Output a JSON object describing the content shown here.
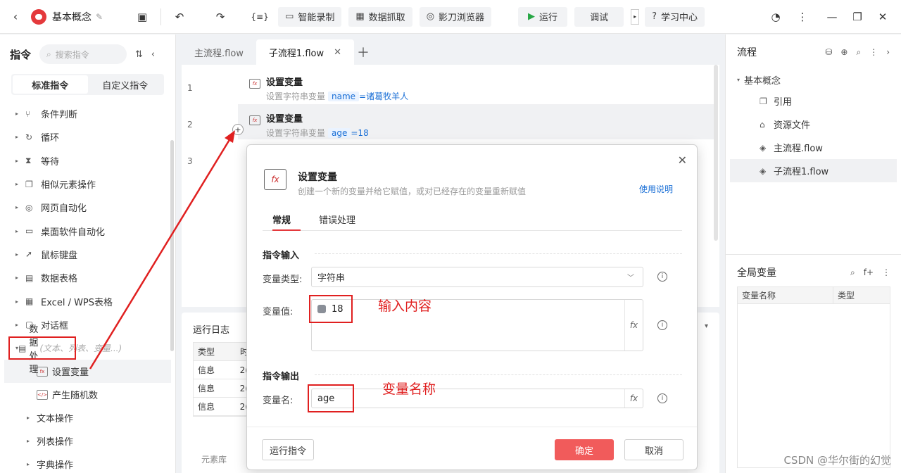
{
  "topbar": {
    "title": "基本概念",
    "buttons": [
      {
        "label": "智能录制",
        "icon": "camera-icon"
      },
      {
        "label": "数据抓取",
        "icon": "table-icon"
      },
      {
        "label": "影刀浏览器",
        "icon": "browser-icon"
      }
    ],
    "run_label": "运行",
    "debug_label": "调试",
    "help_label": "学习中心"
  },
  "left": {
    "title": "指令",
    "search_placeholder": "搜索指令",
    "tabs": [
      "标准指令",
      "自定义指令"
    ],
    "categories": [
      "条件判断",
      "循环",
      "等待",
      "相似元素操作",
      "网页自动化",
      "桌面软件自动化",
      "鼠标键盘",
      "数据表格",
      "Excel / WPS表格",
      "对话框"
    ],
    "active_category": "数据处理",
    "active_hint": "(文本、列表、变量...)",
    "sub_items": [
      "设置变量",
      "产生随机数"
    ],
    "more_categories": [
      "文本操作",
      "列表操作",
      "字典操作"
    ]
  },
  "editor": {
    "tabs": [
      "主流程.flow",
      "子流程1.flow"
    ],
    "line_numbers": [
      "1",
      "2",
      "3"
    ],
    "steps": [
      {
        "title": "设置变量",
        "desc": "设置字符串变量",
        "var": "name",
        "value": "=诸葛牧羊人"
      },
      {
        "title": "设置变量",
        "desc": "设置字符串变量",
        "var": "age",
        "value": "=18"
      }
    ]
  },
  "log": {
    "title": "运行日志",
    "col_type": "类型",
    "col_time": "时",
    "rows": [
      "信息",
      "信息",
      "信息"
    ],
    "row_time": "2(",
    "footer": "元素库"
  },
  "right": {
    "title": "流程",
    "root": "基本概念",
    "items": [
      {
        "label": "引用",
        "icon": "reference-icon"
      },
      {
        "label": "资源文件",
        "icon": "resource-icon"
      },
      {
        "label": "主流程.flow",
        "icon": "flow-icon"
      },
      {
        "label": "子流程1.flow",
        "icon": "flow-icon"
      }
    ],
    "global_title": "全局变量",
    "global_cols": [
      "变量名称",
      "类型"
    ]
  },
  "dialog": {
    "title": "设置变量",
    "desc": "创建一个新的变量并给它赋值，或对已经存在的变量重新赋值",
    "help": "使用说明",
    "tabs": [
      "常规",
      "错误处理"
    ],
    "section_in": "指令输入",
    "type_label": "变量类型:",
    "type_value": "字符串",
    "value_label": "变量值:",
    "value": "18",
    "section_out": "指令输出",
    "name_label": "变量名:",
    "name_value": "age",
    "annot_value": "输入内容",
    "annot_name": "变量名称",
    "run_btn": "运行指令",
    "ok_btn": "确定",
    "cancel_btn": "取消"
  },
  "watermark": "CSDN @华尔街的幻觉",
  "colors": {
    "accent": "#e4393c",
    "link": "#1a6fd6",
    "annotation": "#e02020",
    "ok_button": "#f15b5b"
  }
}
